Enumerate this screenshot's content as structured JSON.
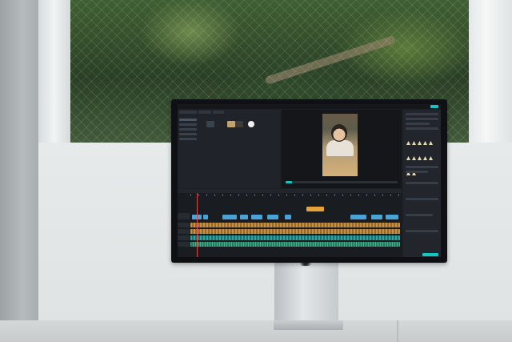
{
  "scene": {
    "description_tokens": [
      "window",
      "wall",
      "desk",
      "monitor"
    ]
  },
  "editor": {
    "window_title": "",
    "export_label": "",
    "caption_text": "",
    "colors": {
      "accent": "#14c6c0",
      "video_clip": "#4aa3d6",
      "title_clip": "#e7a23a",
      "audio_clip": "#c98f3a",
      "audio_clip_2": "#3fb28a",
      "playhead": "#e04848"
    },
    "icons": [
      "media-thumb-icon",
      "play-icon",
      "effect-preset-icon"
    ],
    "preview_progress_fraction": 0.06
  }
}
